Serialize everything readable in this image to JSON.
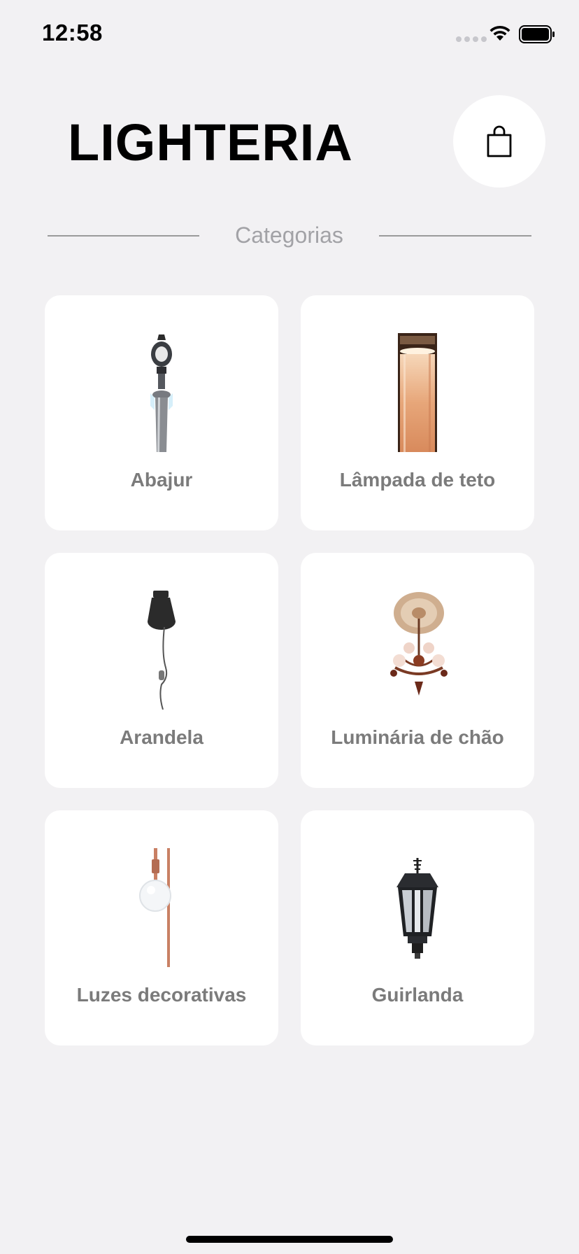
{
  "status_bar": {
    "time": "12:58"
  },
  "header": {
    "title": "LIGHTERIA",
    "cart_icon": "shopping-bag-icon"
  },
  "section": {
    "title": "Categorias"
  },
  "categories": [
    {
      "label": "Abajur",
      "icon": "street-lamp-icon"
    },
    {
      "label": "Lâmpada de teto",
      "icon": "cylinder-lamp-icon"
    },
    {
      "label": "Arandela",
      "icon": "hanging-bulb-icon"
    },
    {
      "label": "Luminária de chão",
      "icon": "chandelier-icon"
    },
    {
      "label": "Luzes decorativas",
      "icon": "globe-bulb-icon"
    },
    {
      "label": "Guirlanda",
      "icon": "lantern-icon"
    }
  ],
  "colors": {
    "background": "#f2f1f3",
    "card": "#ffffff",
    "label": "#7b7b7b",
    "section_title": "#a2a2a6"
  }
}
